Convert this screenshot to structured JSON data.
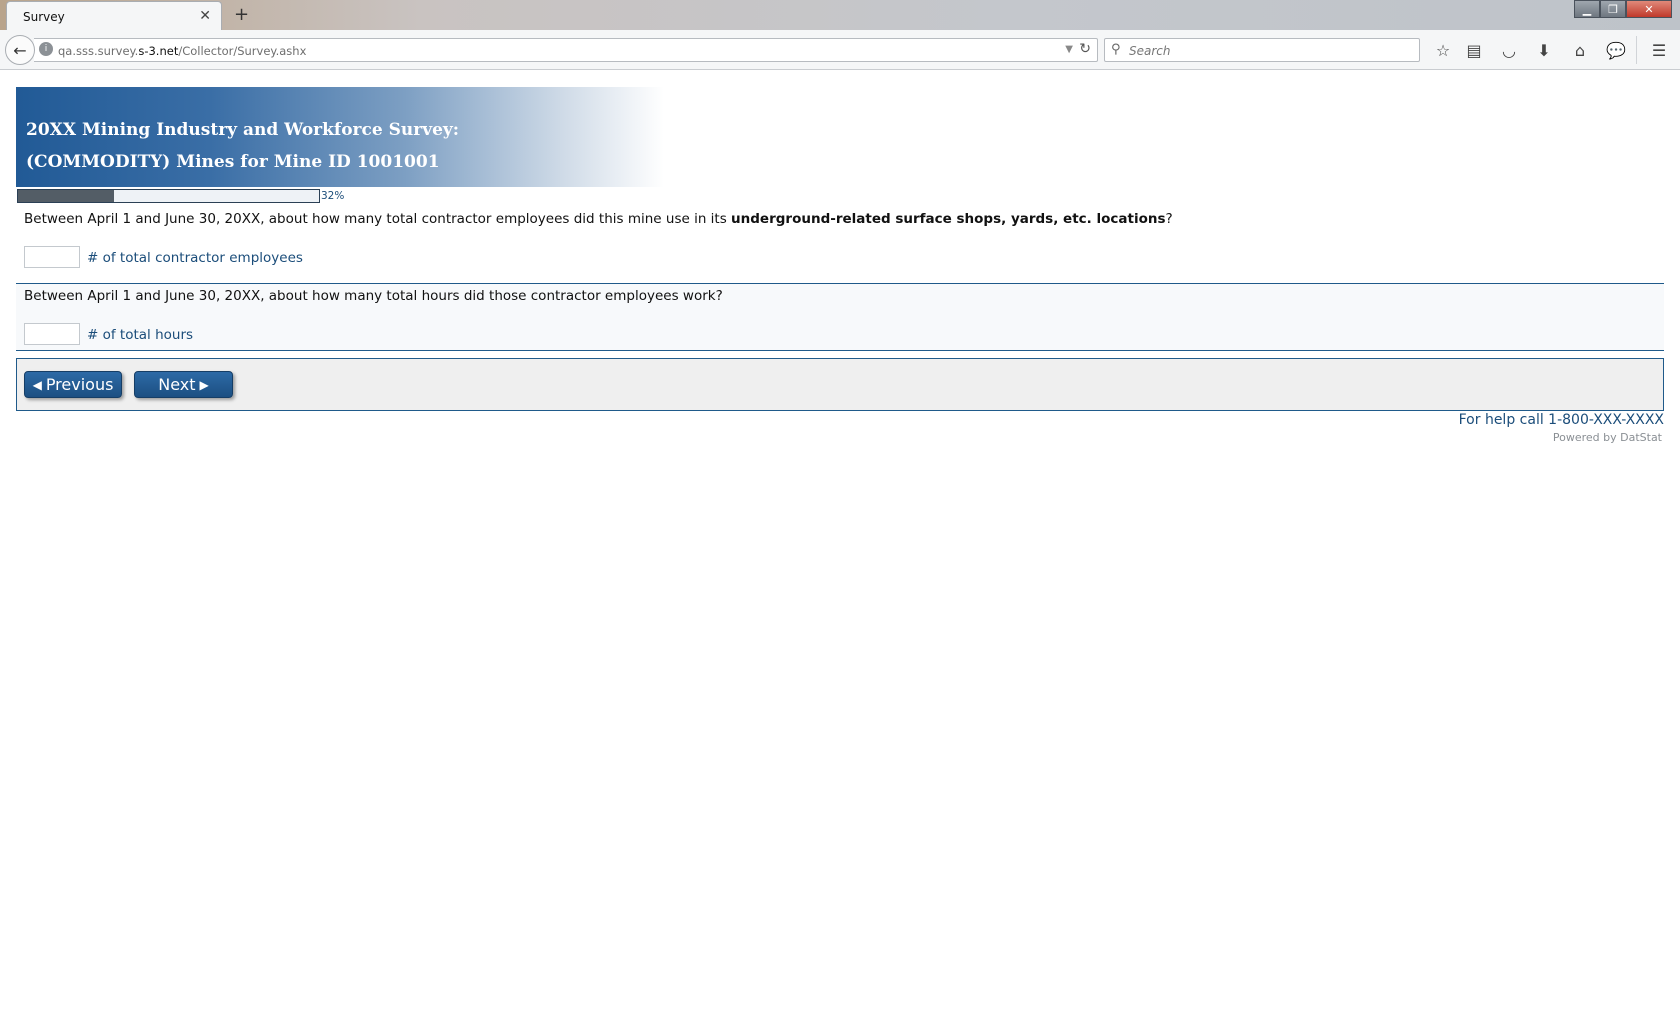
{
  "browser": {
    "tab_title": "Survey",
    "tab_close": "✕",
    "new_tab": "+",
    "url_prefix": "qa.sss.survey.",
    "url_domain": "s-3.net",
    "url_path": "/Collector/Survey.ashx",
    "search_placeholder": "Search",
    "window_controls": {
      "minimize": "▁",
      "restore": "❐",
      "close": "✕"
    },
    "icons": [
      "back-arrow-icon",
      "globe-icon",
      "reload-icon",
      "search-icon",
      "bookmark-star-icon",
      "reading-list-icon",
      "pocket-icon",
      "download-icon",
      "home-icon",
      "chat-icon",
      "hamburger-menu-icon"
    ]
  },
  "survey": {
    "title_line1": "20XX Mining Industry and Workforce Survey:",
    "title_line2": "(COMMODITY) Mines for Mine ID 1001001",
    "progress": {
      "percent": 32,
      "label": "32%"
    },
    "questions": [
      {
        "text_before": "Between April 1 and June 30, 20XX, about how many total contractor employees did this mine use in its ",
        "text_bold": "underground-related surface shops, yards, etc. locations",
        "text_after": "?",
        "input_value": "",
        "suffix": "# of total contractor employees"
      },
      {
        "text_before": "Between April 1 and June 30, 20XX, about how many total hours did those contractor employees work?",
        "input_value": "",
        "suffix": "# of total hours"
      }
    ],
    "buttons": {
      "previous_label": "Previous",
      "previous_arrow": "◀",
      "next_label": "Next",
      "next_arrow": "▶"
    },
    "help_text": "For help call 1-800-XXX-XXXX",
    "powered_by": "Powered by DatStat"
  }
}
